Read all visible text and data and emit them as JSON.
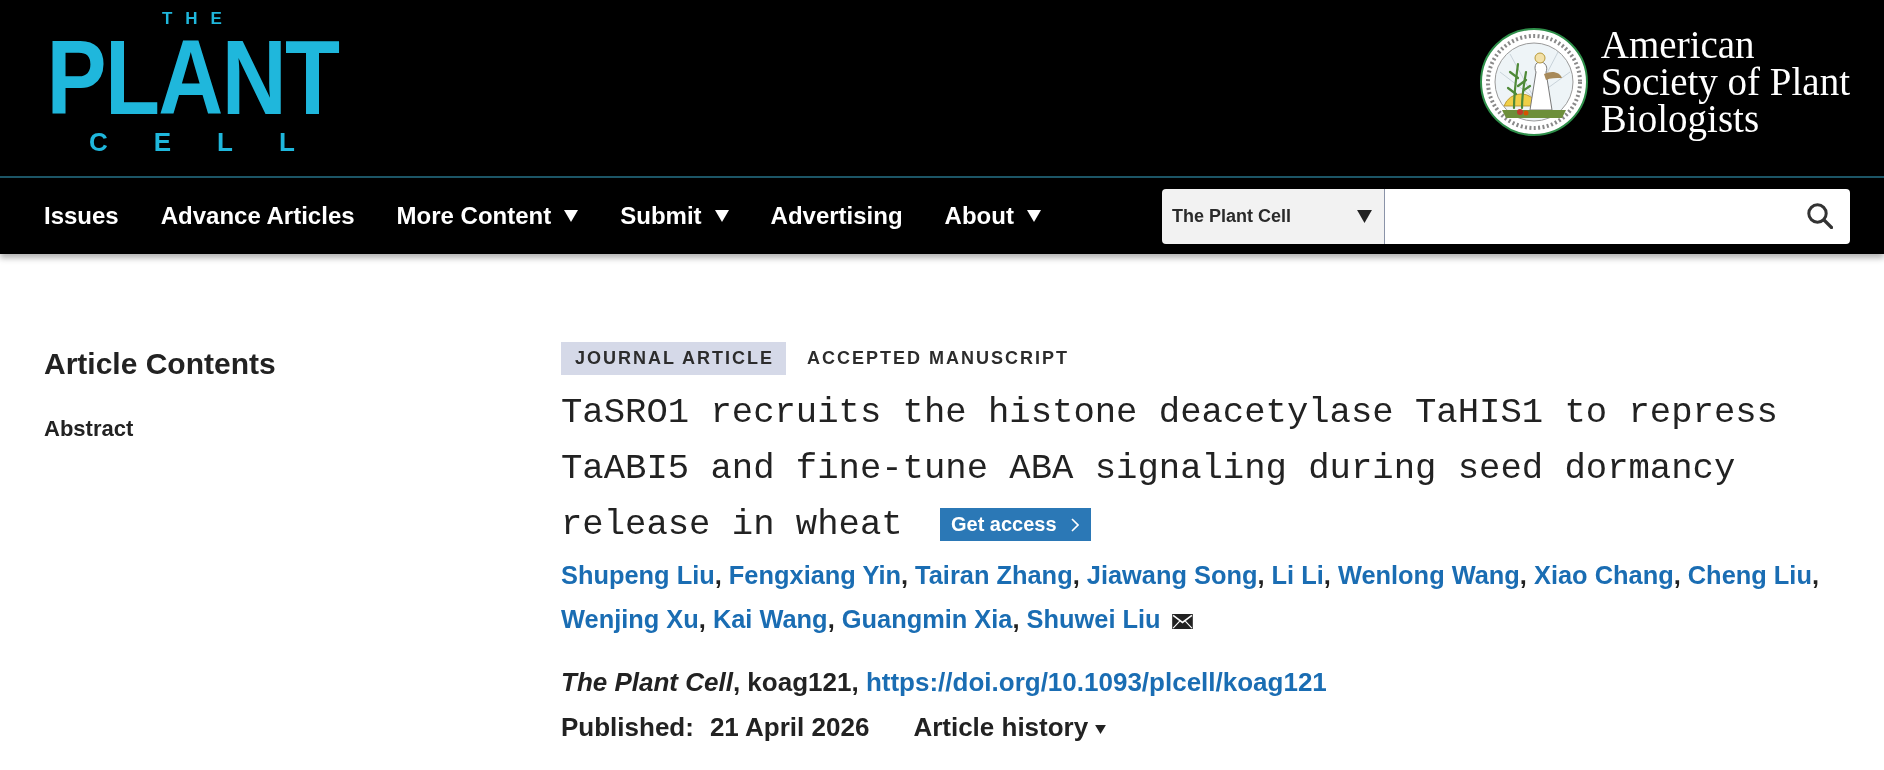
{
  "header": {
    "journal_logo": {
      "top": "THE",
      "main": "PLANT",
      "bottom": "CELL"
    },
    "society_logo": {
      "lines": [
        "American",
        "Society of Plant",
        "Biologists"
      ]
    }
  },
  "nav": {
    "items": [
      {
        "label": "Issues",
        "has_menu": false
      },
      {
        "label": "Advance Articles",
        "has_menu": false
      },
      {
        "label": "More Content",
        "has_menu": true
      },
      {
        "label": "Submit",
        "has_menu": true
      },
      {
        "label": "Advertising",
        "has_menu": false
      },
      {
        "label": "About",
        "has_menu": true
      }
    ],
    "search": {
      "scope": "The Plant Cell"
    }
  },
  "sidebar": {
    "title": "Article Contents",
    "items": [
      {
        "label": "Abstract"
      }
    ]
  },
  "article": {
    "tags": [
      {
        "label": "JOURNAL ARTICLE",
        "kind": "filled"
      },
      {
        "label": "ACCEPTED MANUSCRIPT",
        "kind": "plain"
      }
    ],
    "title": "TaSRO1 recruits the histone deacetylase TaHIS1 to repress TaABI5 and fine-tune ABA signaling during seed dormancy release in wheat",
    "access_button": "Get access",
    "authors": [
      {
        "name": "Shupeng Liu",
        "suffix": ",",
        "corresponding": false
      },
      {
        "name": "Fengxiang Yin",
        "suffix": ",",
        "corresponding": false
      },
      {
        "name": "Tairan Zhang",
        "suffix": ",",
        "corresponding": false
      },
      {
        "name": "Jiawang Song",
        "suffix": ",",
        "corresponding": false
      },
      {
        "name": "Li Li",
        "suffix": ",",
        "corresponding": false
      },
      {
        "name": "Wenlong Wang",
        "suffix": ",",
        "corresponding": false
      },
      {
        "name": "Xiao Chang",
        "suffix": ",",
        "corresponding": false
      },
      {
        "name": "Cheng Liu",
        "suffix": ",",
        "corresponding": false
      },
      {
        "name": "Wenjing Xu",
        "suffix": ",",
        "corresponding": false
      },
      {
        "name": "Kai Wang",
        "suffix": ",",
        "corresponding": false
      },
      {
        "name": "Guangmin Xia",
        "suffix": ",",
        "corresponding": false
      },
      {
        "name": "Shuwei Liu",
        "corresponding": true
      }
    ],
    "citation": {
      "text": "*The Plant Cell*, koag121,",
      "doi": "https://doi.org/10.1093/plcell/koag121"
    },
    "published": {
      "label": "Published:",
      "date": "21 April 2026"
    },
    "history_button": "Article history"
  }
}
